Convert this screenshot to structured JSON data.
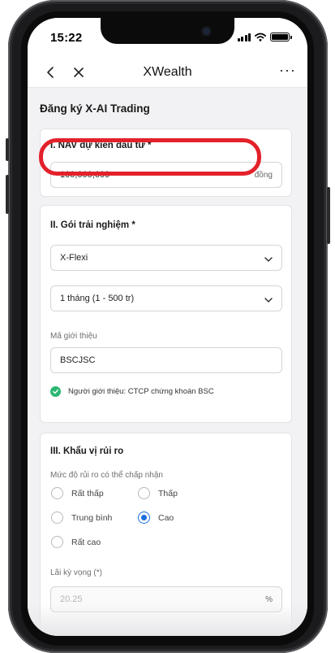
{
  "status_bar": {
    "time": "15:22"
  },
  "nav": {
    "title": "XWealth",
    "back_icon": "chevron-left-icon",
    "close_icon": "close-icon",
    "more_label": "···"
  },
  "page": {
    "heading": "Đăng ký X-AI Trading"
  },
  "section_nav": {
    "title": "I. NAV dự kiến đầu tư *",
    "value": "100,000,000",
    "unit": "đồng"
  },
  "section_package": {
    "title": "II. Gói trải nghiệm *",
    "package_select": "X-Flexi",
    "duration_select": "1 tháng (1 - 500 tr)",
    "referral_label": "Mã giới thiệu",
    "referral_code": "BSCJSC",
    "referrer_note": "Người giới thiệu: CTCP chứng khoán BSC"
  },
  "section_risk": {
    "title": "III. Khẩu vị rủi ro",
    "risk_level_label": "Mức độ rủi ro có thể chấp nhận",
    "options": [
      {
        "label": "Rất thấp",
        "selected": false
      },
      {
        "label": "Thấp",
        "selected": false
      },
      {
        "label": "Trung bình",
        "selected": false
      },
      {
        "label": "Cao",
        "selected": true
      },
      {
        "label": "Rất cao",
        "selected": false
      }
    ],
    "expected_return_label": "Lãi kỳ vọng (*)",
    "expected_return_value": "20.25",
    "expected_return_unit": "%"
  },
  "colors": {
    "highlight": "#e3212b",
    "radio_selected": "#1e6fe0",
    "check_green": "#2bb673"
  }
}
